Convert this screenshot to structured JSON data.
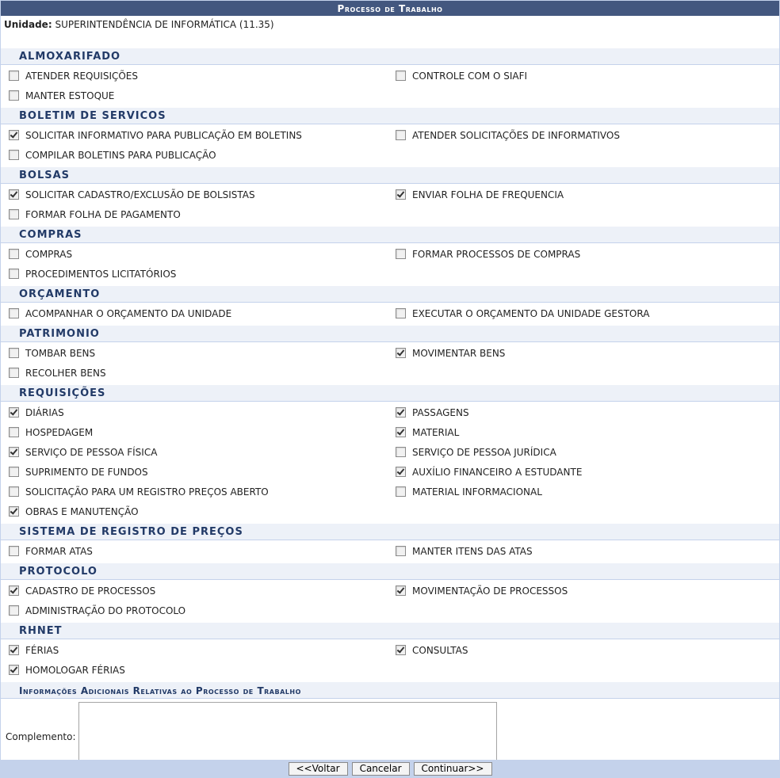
{
  "title": "Processo de Trabalho",
  "unit": {
    "label": "Unidade:",
    "value": "SUPERINTENDÊNCIA DE INFORMÁTICA (11.35)"
  },
  "groups": [
    {
      "name": "ALMOXARIFADO",
      "items": [
        {
          "label": "ATENDER REQUISIÇÕES",
          "checked": false
        },
        {
          "label": "CONTROLE COM O SIAFI",
          "checked": false
        },
        {
          "label": "MANTER ESTOQUE",
          "checked": false
        }
      ]
    },
    {
      "name": "BOLETIM DE SERVICOS",
      "items": [
        {
          "label": "SOLICITAR INFORMATIVO PARA PUBLICAÇÃO EM BOLETINS",
          "checked": true
        },
        {
          "label": "ATENDER SOLICITAÇÕES DE INFORMATIVOS",
          "checked": false
        },
        {
          "label": "COMPILAR BOLETINS PARA PUBLICAÇÃO",
          "checked": false
        }
      ]
    },
    {
      "name": "BOLSAS",
      "items": [
        {
          "label": "SOLICITAR CADASTRO/EXCLUSÃO DE BOLSISTAS",
          "checked": true
        },
        {
          "label": "ENVIAR FOLHA DE FREQUENCIA",
          "checked": true
        },
        {
          "label": "FORMAR FOLHA DE PAGAMENTO",
          "checked": false
        }
      ]
    },
    {
      "name": "COMPRAS",
      "items": [
        {
          "label": "COMPRAS",
          "checked": false
        },
        {
          "label": "FORMAR PROCESSOS DE COMPRAS",
          "checked": false
        },
        {
          "label": "PROCEDIMENTOS LICITATÓRIOS",
          "checked": false
        }
      ]
    },
    {
      "name": "ORÇAMENTO",
      "items": [
        {
          "label": "ACOMPANHAR O ORÇAMENTO DA UNIDADE",
          "checked": false
        },
        {
          "label": "EXECUTAR O ORÇAMENTO DA UNIDADE GESTORA",
          "checked": false
        }
      ]
    },
    {
      "name": "PATRIMONIO",
      "items": [
        {
          "label": "TOMBAR BENS",
          "checked": false
        },
        {
          "label": "MOVIMENTAR BENS",
          "checked": true
        },
        {
          "label": "RECOLHER BENS",
          "checked": false
        }
      ]
    },
    {
      "name": "REQUISIÇÕES",
      "items": [
        {
          "label": "DIÁRIAS",
          "checked": true
        },
        {
          "label": "PASSAGENS",
          "checked": true
        },
        {
          "label": "HOSPEDAGEM",
          "checked": false
        },
        {
          "label": "MATERIAL",
          "checked": true
        },
        {
          "label": "SERVIÇO DE PESSOA FÍSICA",
          "checked": true
        },
        {
          "label": "SERVIÇO DE PESSOA JURÍDICA",
          "checked": false
        },
        {
          "label": "SUPRIMENTO DE FUNDOS",
          "checked": false
        },
        {
          "label": "AUXÍLIO FINANCEIRO A ESTUDANTE",
          "checked": true
        },
        {
          "label": "SOLICITAÇÃO PARA UM REGISTRO PREÇOS ABERTO",
          "checked": false
        },
        {
          "label": "MATERIAL INFORMACIONAL",
          "checked": false
        },
        {
          "label": "OBRAS E MANUTENÇÃO",
          "checked": true
        }
      ]
    },
    {
      "name": "SISTEMA DE REGISTRO DE PREÇOS",
      "items": [
        {
          "label": "FORMAR ATAS",
          "checked": false
        },
        {
          "label": "MANTER ITENS DAS ATAS",
          "checked": false
        }
      ]
    },
    {
      "name": "PROTOCOLO",
      "items": [
        {
          "label": "CADASTRO DE PROCESSOS",
          "checked": true
        },
        {
          "label": "MOVIMENTAÇÃO DE PROCESSOS",
          "checked": true
        },
        {
          "label": "ADMINISTRAÇÃO DO PROTOCOLO",
          "checked": false
        }
      ]
    },
    {
      "name": "RHNET",
      "items": [
        {
          "label": "FÉRIAS",
          "checked": true
        },
        {
          "label": "CONSULTAS",
          "checked": true
        },
        {
          "label": "HOMOLOGAR FÉRIAS",
          "checked": true
        }
      ]
    }
  ],
  "extra": {
    "header": "Informações Adicionais Relativas ao Processo de Trabalho",
    "complement_label": "Complemento:",
    "complement_value": ""
  },
  "buttons": {
    "back": "<<Voltar",
    "cancel": "Cancelar",
    "continue": "Continuar>>"
  }
}
